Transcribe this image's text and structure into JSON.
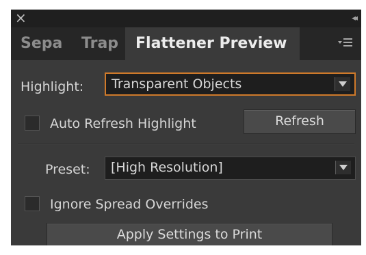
{
  "window": {
    "close_glyph": "×",
    "collapse_glyph": "◂◂"
  },
  "tabs": [
    {
      "label": "Sepa",
      "active": false
    },
    {
      "label": "Trap",
      "active": false
    },
    {
      "label": "Flattener Preview",
      "active": true
    }
  ],
  "panel_menu_icon": "hamburger-menu-icon",
  "highlight": {
    "label": "Highlight:",
    "value": "Transparent Objects"
  },
  "auto_refresh": {
    "label": "Auto Refresh Highlight",
    "checked": false
  },
  "refresh_button": "Refresh",
  "preset": {
    "label": "Preset:",
    "value": "[High Resolution]"
  },
  "ignore_spread": {
    "label": "Ignore Spread Overrides",
    "checked": false
  },
  "apply_button": "Apply Settings to Print",
  "colors": {
    "panel_bg": "#3a3a3a",
    "focus_border": "#d07a2a"
  }
}
